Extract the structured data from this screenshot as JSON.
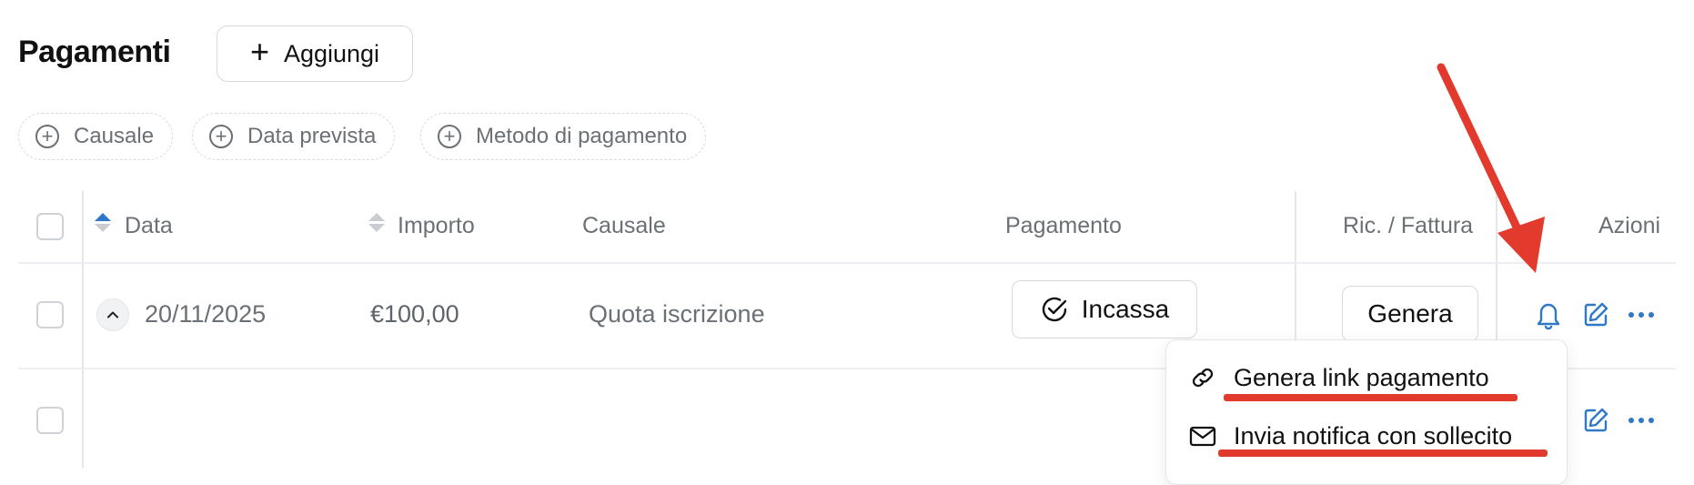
{
  "header": {
    "title": "Pagamenti",
    "add_label": "Aggiungi"
  },
  "filters": [
    {
      "label": "Causale"
    },
    {
      "label": "Data prevista"
    },
    {
      "label": "Metodo di pagamento"
    }
  ],
  "table": {
    "columns": {
      "data": "Data",
      "importo": "Importo",
      "causale": "Causale",
      "pagamento": "Pagamento",
      "ricevuta": "Ric. / Fattura",
      "azioni": "Azioni"
    },
    "rows": [
      {
        "data": "20/11/2025",
        "importo": "€100,00",
        "causale": "Quota iscrizione",
        "pay_button": "Incassa",
        "receipt_button": "Genera"
      }
    ]
  },
  "dropdown": {
    "items": [
      {
        "label": "Genera link pagamento",
        "icon": "link-icon"
      },
      {
        "label": "Invia notifica con sollecito",
        "icon": "mail-icon"
      }
    ]
  },
  "colors": {
    "accent": "#2e78c7",
    "annotation": "#e23b2e"
  }
}
